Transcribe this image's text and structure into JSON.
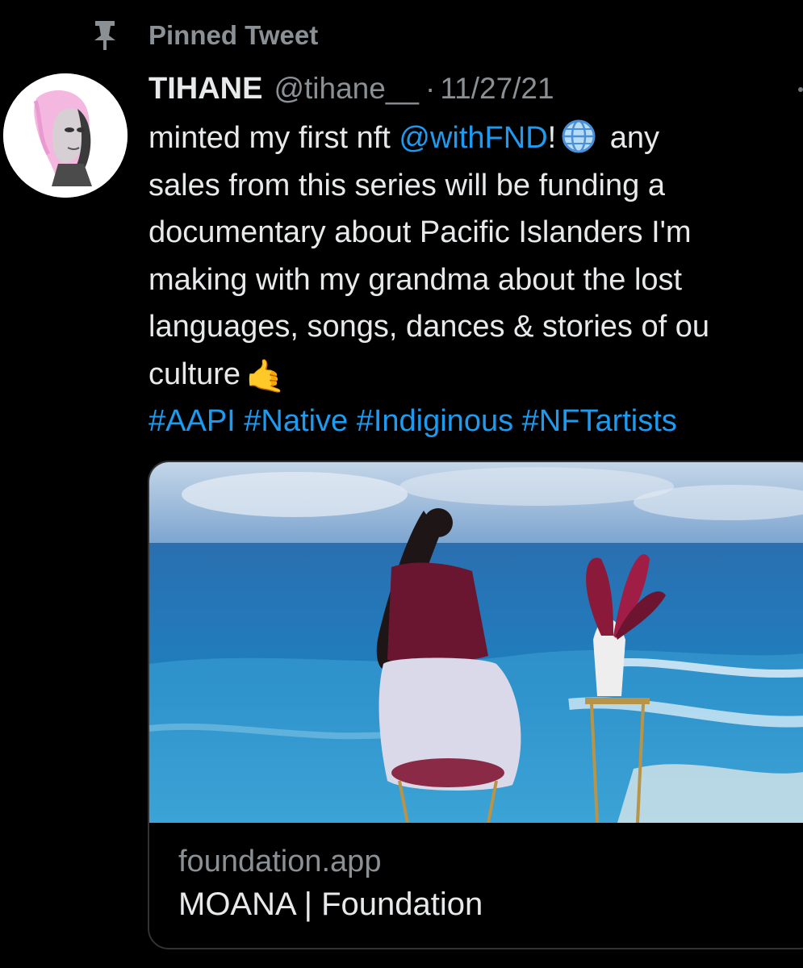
{
  "pinned": {
    "label": "Pinned Tweet"
  },
  "tweet": {
    "author_name": "TIHANE",
    "handle": "@tihane__",
    "separator": "·",
    "date": "11/27/21",
    "lines": [
      {
        "pre": "minted my first nft ",
        "mention": "@withFND",
        "post_mention": "!",
        "post_emoji": " any"
      },
      {
        "text": "sales from this series will be funding a"
      },
      {
        "text": "documentary about Pacific Islanders I'm"
      },
      {
        "text": "making with my grandma about the lost"
      },
      {
        "text": "languages, songs, dances & stories of ou"
      },
      {
        "text": "culture",
        "emoji": "🤙"
      }
    ],
    "hashtags": [
      "#AAPI",
      "#Native",
      "#Indiginous",
      "#NFTartists"
    ]
  },
  "card": {
    "domain": "foundation.app",
    "title": "MOANA | Foundation"
  },
  "icons": {
    "pin": "pin-icon",
    "globe": "globe-icon",
    "more": "more-icon"
  },
  "colors": {
    "background": "#000000",
    "link": "#1d9bf0",
    "secondary_text": "#8b9095",
    "primary_text": "#e7e9ea"
  }
}
